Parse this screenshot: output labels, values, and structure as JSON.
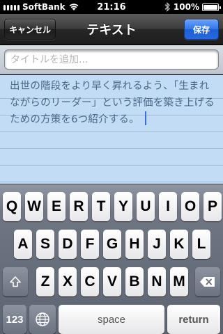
{
  "status_bar": {
    "carrier": "SoftBank",
    "time": "21:16",
    "battery": "100%",
    "icons": [
      "signal-icon",
      "wifi-icon",
      "bluetooth-icon",
      "battery-icon"
    ]
  },
  "nav": {
    "cancel_label": "キャンセル",
    "title": "テキスト",
    "save_label": "保存"
  },
  "title_field": {
    "placeholder": "タイトルを追加...",
    "value": ""
  },
  "note": {
    "text": "出世の階段をより早く昇れるよう、「生まれながらのリーダー」という評価を築き上げるための方策を6つ紹介する。"
  },
  "keyboard": {
    "row1": [
      "Q",
      "W",
      "E",
      "R",
      "T",
      "Y",
      "U",
      "I",
      "O",
      "P"
    ],
    "row2": [
      "A",
      "S",
      "D",
      "F",
      "G",
      "H",
      "J",
      "K",
      "L"
    ],
    "row3": [
      "Z",
      "X",
      "C",
      "V",
      "B",
      "N",
      "M"
    ],
    "num_label": "123",
    "space_label": "space",
    "return_label": "return",
    "icons": [
      "shift-icon",
      "backspace-icon",
      "globe-icon"
    ]
  },
  "colors": {
    "save_blue": "#2f76e8",
    "note_bg": "#c2dcf5",
    "note_line": "#94bde6",
    "note_text": "#4a6786"
  }
}
